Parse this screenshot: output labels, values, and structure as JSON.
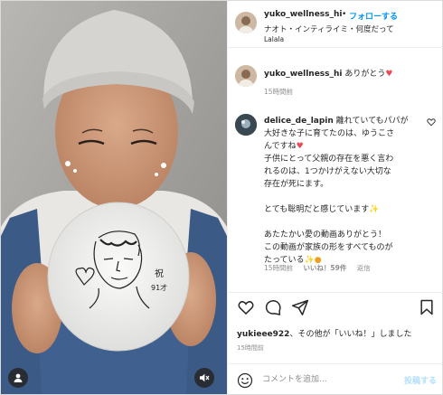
{
  "header": {
    "username": "yuko_wellness_hi",
    "separator": "•",
    "follow_label": "フォローする",
    "music": "ナオト・インティライミ・何度だって",
    "location": "Lalala"
  },
  "comments": [
    {
      "username": "yuko_wellness_hi",
      "text": "ありがとう",
      "time": "15時間前"
    },
    {
      "username": "delice_de_lapin",
      "lines": [
        "離れていてもパパが",
        "大好きな子に育てたのは、ゆうこさ",
        "んですね",
        "子供にとって父親の存在を悪く言わ",
        "れるのは、1つかけがえない大切な",
        "存在が死にます。",
        "",
        "とても聡明だと感じています",
        "",
        "あたたかい愛の動画ありがとう！",
        "この動画が家族の形をすべてものが",
        "たっている"
      ],
      "time": "15時間前",
      "likes": "いいね！59件",
      "reply_label": "返信"
    }
  ],
  "actions": {
    "liked_by_user": "yukieee922",
    "liked_by_rest": "、その他が「いいね！」しました",
    "post_time": "15時間前"
  },
  "composer": {
    "placeholder": "コメントを追加...",
    "post_label": "投稿する"
  },
  "media": {
    "drawing_caption": "祝\n91才"
  },
  "colors": {
    "link_blue": "#0095f6",
    "heart_red": "#ed4956",
    "muted_text": "#8e8e8e",
    "post_disabled": "#b2dffc"
  },
  "icons": [
    "heart-icon",
    "comment-icon",
    "share-icon",
    "bookmark-icon",
    "emoji-icon",
    "user-tag-icon",
    "speaker-muted-icon",
    "more-icon"
  ]
}
